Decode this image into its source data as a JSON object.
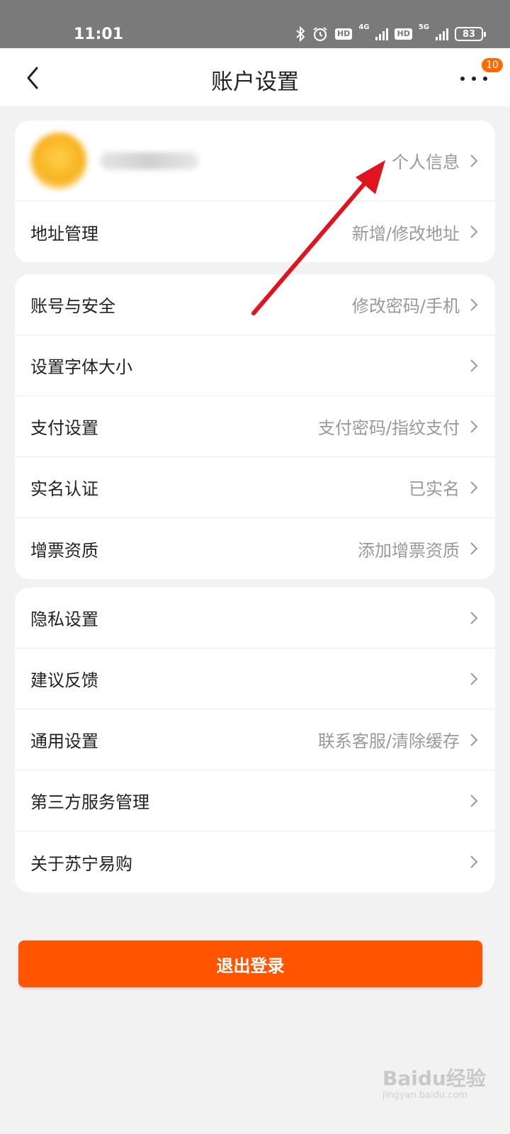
{
  "status_bar": {
    "time": "11:01",
    "hd1": "HD",
    "net1": "4G",
    "hd2": "HD",
    "net2": "5G",
    "battery": "83"
  },
  "header": {
    "title": "账户设置",
    "badge": "10"
  },
  "profile": {
    "link_label": "个人信息"
  },
  "card1": [
    {
      "label": "地址管理",
      "value": "新增/修改地址"
    }
  ],
  "card2": [
    {
      "label": "账号与安全",
      "value": "修改密码/手机"
    },
    {
      "label": "设置字体大小",
      "value": ""
    },
    {
      "label": "支付设置",
      "value": "支付密码/指纹支付"
    },
    {
      "label": "实名认证",
      "value": "已实名"
    },
    {
      "label": "增票资质",
      "value": "添加增票资质"
    }
  ],
  "card3": [
    {
      "label": "隐私设置",
      "value": ""
    },
    {
      "label": "建议反馈",
      "value": ""
    },
    {
      "label": "通用设置",
      "value": "联系客服/清除缓存"
    },
    {
      "label": "第三方服务管理",
      "value": ""
    },
    {
      "label": "关于苏宁易购",
      "value": ""
    }
  ],
  "logout_label": "退出登录",
  "watermark": {
    "brand": "Baidu经验",
    "url": "jingyan.baidu.com"
  },
  "colors": {
    "accent": "#ff5500",
    "badge": "#ff6a00",
    "annotation_arrow": "#e0141e"
  }
}
